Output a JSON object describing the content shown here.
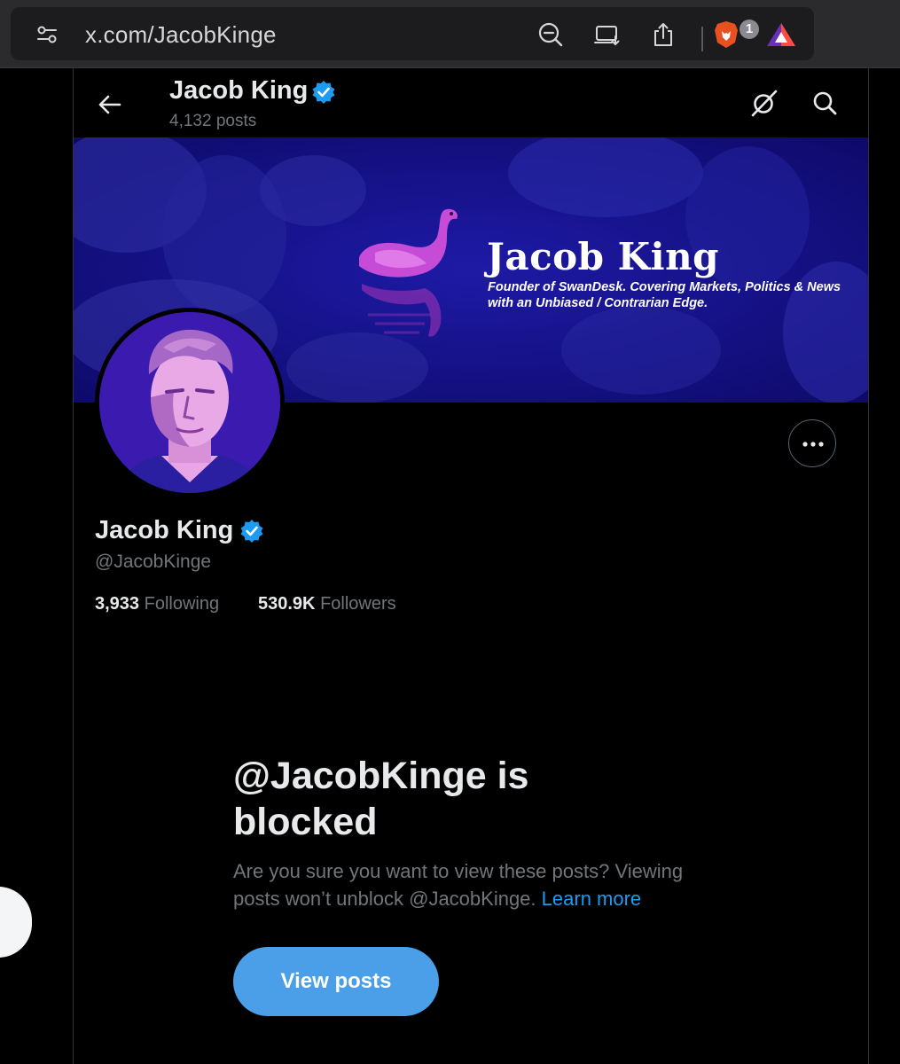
{
  "browser": {
    "url": "x.com/JacobKinge",
    "brave_badge_count": "1",
    "icons": [
      "site-settings-icon",
      "zoom-out-icon",
      "cast-icon",
      "share-icon",
      "brave-shields-icon",
      "brave-rewards-icon"
    ]
  },
  "header": {
    "name": "Jacob King",
    "posts_count": "4,132 posts"
  },
  "banner": {
    "title": "Jacob King",
    "subtitle": "Founder of SwanDesk. Covering Markets, Politics & News with an Unbiased / Contrarian Edge."
  },
  "profile": {
    "display_name": "Jacob King",
    "handle": "@JacobKinge",
    "following_count": "3,933",
    "following_label": "Following",
    "followers_count": "530.9K",
    "followers_label": "Followers",
    "verified_color": "#1d9bf0"
  },
  "blocked": {
    "title": "@JacobKinge is blocked",
    "description": "Are you sure you want to view these posts? Viewing posts won’t unblock @JacobKinge.",
    "learn_more": "Learn more",
    "button": "View posts"
  },
  "colors": {
    "accent": "#1d9bf0",
    "button": "#4a9fe8",
    "banner": "#16118c"
  }
}
